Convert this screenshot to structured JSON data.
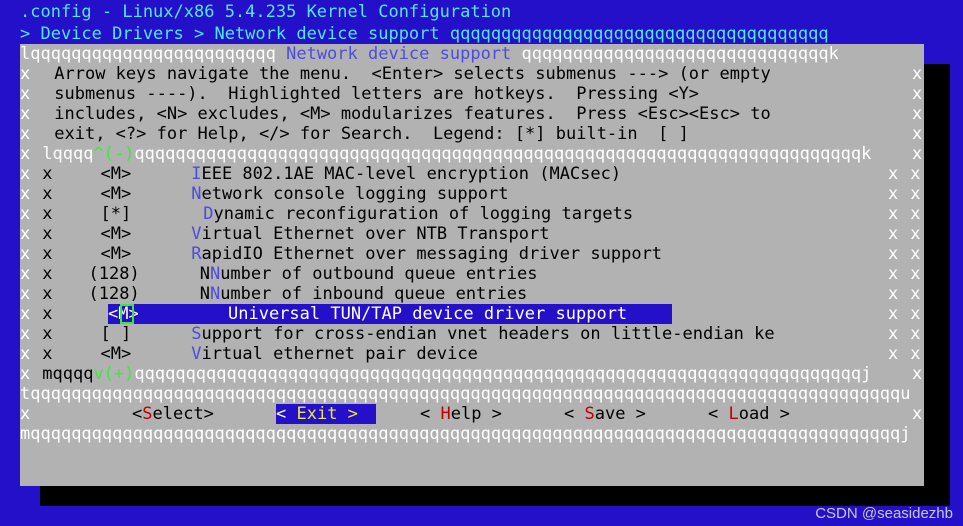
{
  "window": {
    "title": ".config - Linux/x86 5.4.235 Kernel Configuration",
    "breadcrumb": "> Device Drivers > Network device support ",
    "breadcrumb_fill": "qqqqqqqqqqqqqqqqqqqqqqqqqqqqqqqqqqqqq"
  },
  "dialog": {
    "title": "Network device support",
    "top_left_fill": "lqqqqqqqqqqqqqqqqqqqqqqqq ",
    "top_right_fill": " qqqqqqqqqqqqqqqqqqqqqqqqqqqqqqk",
    "help_lines": [
      "Arrow keys navigate the menu.  <Enter> selects submenus ---> (or empty",
      "submenus ----).  Highlighted letters are hotkeys.  Pressing <Y>",
      "includes, <N> excludes, <M> modularizes features.  Press <Esc><Esc> to",
      "exit, <?> for Help, </> for Search.  Legend: [*] built-in  [ ]"
    ],
    "inner_top": {
      "prefix": "lqqqq",
      "up_arrow": "^(-)",
      "fill": "qqqqqqqqqqqqqqqqqqqqqqqqqqqqqqqqqqqqqqqqqqqqqqqqqqqqqqqqqqqqqqqqqqqqqqq",
      "corner": "k"
    },
    "inner_bottom": {
      "prefix": "mqqqq",
      "down_arrow": "v(+)",
      "fill": "qqqqqqqqqqqqqqqqqqqqqqqqqqqqqqqqqqqqqqqqqqqqqqqqqqqqqqqqqqqqqqqqqqqqqqq",
      "corner": "j"
    },
    "separator_left": "t",
    "separator_fill": "qqqqqqqqqqqqqqqqqqqqqqqqqqqqqqqqqqqqqqqqqqqqqqqqqqqqqqqqqqqqqqqqqqqqqqqqqqqqqqqqqqqqq",
    "separator_right": "u",
    "bottom_left": "m",
    "bottom_fill": "qqqqqqqqqqqqqqqqqqqqqqqqqqqqqqqqqqqqqqqqqqqqqqqqqqqqqqqqqqqqqqqqqqqqqqqqqqqqqqqqqqqqq",
    "bottom_right": "j",
    "side_char": "x"
  },
  "menu": {
    "items": [
      {
        "state": "<M>",
        "hot": "I",
        "rest": "EEE 802.1AE MAC-level encryption (MACsec)",
        "indent": 0,
        "selected": false
      },
      {
        "state": "<M>",
        "hot": "N",
        "rest": "etwork console logging support",
        "indent": 0,
        "selected": false
      },
      {
        "state": "[*]",
        "hot": "D",
        "rest": "ynamic reconfiguration of logging targets",
        "indent": 1,
        "selected": false
      },
      {
        "state": "<M>",
        "hot": "V",
        "rest": "irtual Ethernet over NTB Transport",
        "indent": 0,
        "selected": false
      },
      {
        "state": "<M>",
        "hot": "R",
        "rest": "apidIO Ethernet over messaging driver support",
        "indent": 0,
        "selected": false
      },
      {
        "state": "(128)",
        "hot": "N",
        "rest": "umber of outbound queue entries",
        "indent": 1,
        "selected": false,
        "hot_index": 1,
        "prefix": "N"
      },
      {
        "state": "(128)",
        "hot": "N",
        "rest": "umber of inbound queue entries",
        "indent": 1,
        "selected": false,
        "hot_index": 1,
        "prefix": "N"
      },
      {
        "state": "<M>",
        "hot": "U",
        "rest": "niversal TUN/TAP device driver support",
        "indent": 0,
        "selected": true
      },
      {
        "state": "[ ]",
        "hot": "S",
        "rest": "upport for cross-endian vnet headers on little-endian ke",
        "indent": 0,
        "selected": false
      },
      {
        "state": "<M>",
        "hot": "V",
        "rest": "irtual ethernet pair device",
        "indent": 0,
        "selected": false
      }
    ],
    "selected_index": 7,
    "selected_state": "<M>",
    "selected_cursor_char": "M",
    "selected_label": "Universal TUN/TAP device driver support"
  },
  "buttons": [
    {
      "label": "<Select>",
      "pre": "<",
      "hot": "S",
      "post": "elect>",
      "selected": false
    },
    {
      "label": "< Exit >",
      "pre": "< ",
      "hot": "E",
      "post": "xit >",
      "selected": true
    },
    {
      "label": "< Help >",
      "pre": "< ",
      "hot": "H",
      "post": "elp >",
      "selected": false
    },
    {
      "label": "< Save >",
      "pre": "< ",
      "hot": "S",
      "post": "ave >",
      "selected": false
    },
    {
      "label": "< Load >",
      "pre": "< ",
      "hot": "L",
      "post": "oad >",
      "selected": false
    }
  ],
  "watermark": "CSDN @seasidezhb",
  "colors": {
    "background": "#2310c8",
    "dialog": "#b2b2b2",
    "backtitle_text": "#4fe9e9",
    "dialog_title": "#4c4ce0",
    "hotkey": "#4c4ce0",
    "button_hotkey": "#c00000",
    "selection_bg": "#2310c8",
    "selection_fg": "#ffffff",
    "cursor_green": "#3ce83c",
    "selected_hotkey": "#e8e840"
  }
}
